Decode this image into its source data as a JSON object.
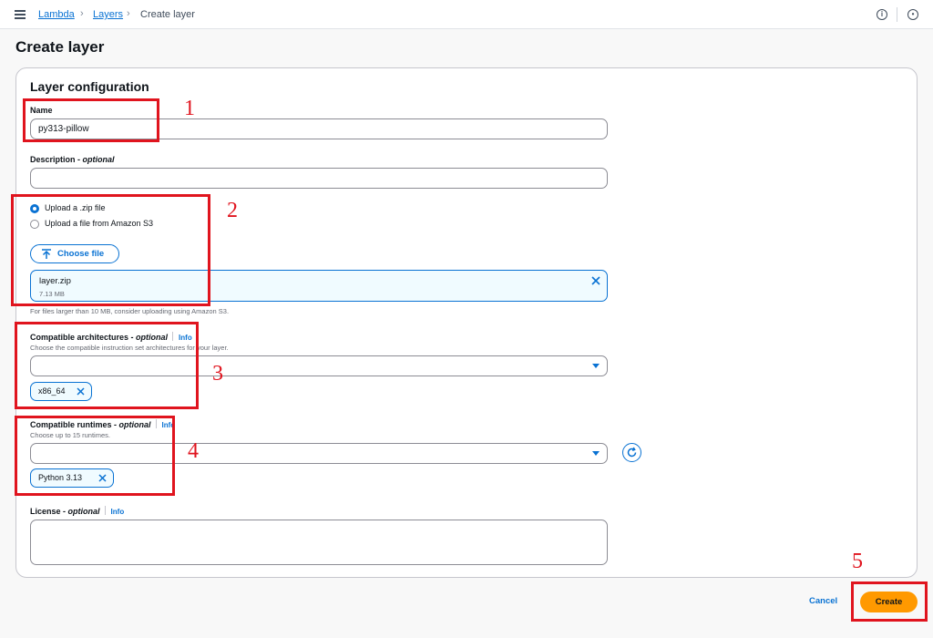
{
  "breadcrumb": {
    "items": [
      "Lambda",
      "Layers",
      "Create layer"
    ]
  },
  "page": {
    "title": "Create layer"
  },
  "panel": {
    "title": "Layer configuration"
  },
  "name_field": {
    "label": "Name",
    "value": "py313-pillow"
  },
  "description_field": {
    "label": "Description",
    "optional": "- optional",
    "value": ""
  },
  "upload": {
    "options": [
      {
        "label": "Upload a .zip file",
        "selected": true
      },
      {
        "label": "Upload a file from Amazon S3",
        "selected": false
      }
    ],
    "choose_label": "Choose file",
    "file_name": "layer.zip",
    "file_size": "7.13 MB",
    "hint": "For files larger than 10 MB, consider uploading using Amazon S3."
  },
  "architectures": {
    "label": "Compatible architectures",
    "optional": "- optional",
    "info": "Info",
    "hint": "Choose the compatible instruction set architectures for your layer.",
    "selected_token": "x86_64"
  },
  "runtimes": {
    "label": "Compatible runtimes",
    "optional": "- optional",
    "info": "Info",
    "hint": "Choose up to 15 runtimes.",
    "selected_token": "Python 3.13"
  },
  "license": {
    "label": "License",
    "optional": "- optional",
    "info": "Info",
    "value": ""
  },
  "actions": {
    "cancel": "Cancel",
    "create": "Create"
  },
  "annotations": [
    "1",
    "2",
    "3",
    "4",
    "5"
  ],
  "colors": {
    "link": "#0972d3",
    "primary_button": "#ff9900",
    "annotation": "#e0141e",
    "token_bg": "#f0fbff"
  },
  "icons": [
    "menu-icon",
    "info-icon",
    "settings-icon",
    "upload-icon",
    "close-icon",
    "caret-down-icon",
    "refresh-icon",
    "resize-icon"
  ]
}
